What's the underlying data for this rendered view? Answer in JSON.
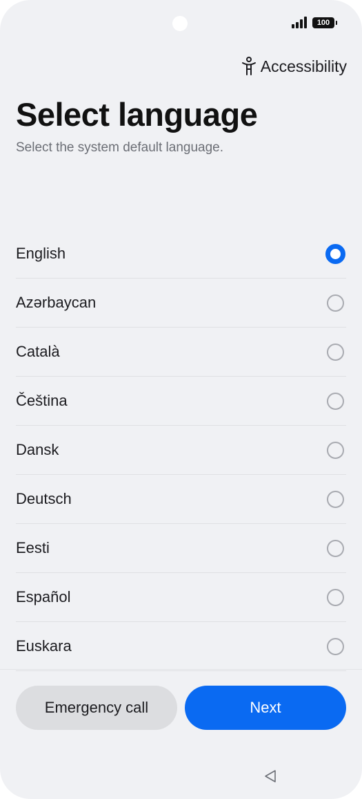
{
  "status_bar": {
    "battery_level": "100",
    "signal_icon": "cellular-signal-icon"
  },
  "header": {
    "accessibility_label": "Accessibility",
    "accessibility_icon": "accessibility-person-icon",
    "title": "Select language",
    "subtitle": "Select the system default language."
  },
  "languages": {
    "selected": "English",
    "items": [
      {
        "label": "English",
        "selected": true
      },
      {
        "label": "Azərbaycan",
        "selected": false
      },
      {
        "label": "Català",
        "selected": false
      },
      {
        "label": "Čeština",
        "selected": false
      },
      {
        "label": "Dansk",
        "selected": false
      },
      {
        "label": "Deutsch",
        "selected": false
      },
      {
        "label": "Eesti",
        "selected": false
      },
      {
        "label": "Español",
        "selected": false
      },
      {
        "label": "Euskara",
        "selected": false
      }
    ]
  },
  "footer": {
    "emergency_label": "Emergency call",
    "next_label": "Next"
  },
  "colors": {
    "accent": "#0a6af2",
    "background": "#f0f1f4",
    "secondary_button": "#dcdde0"
  },
  "nav": {
    "back_icon": "back-triangle-icon"
  }
}
